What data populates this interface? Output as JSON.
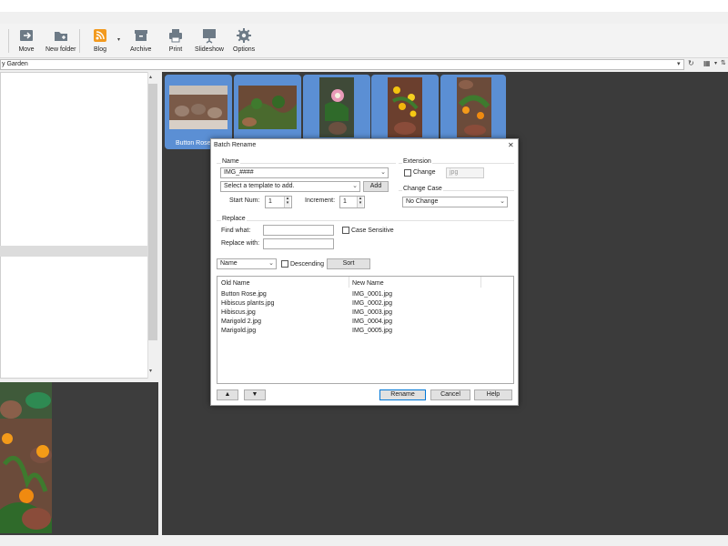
{
  "toolbar": {
    "buttons": [
      {
        "id": "move",
        "label": "Move"
      },
      {
        "id": "newfolder",
        "label": "New folder"
      },
      {
        "id": "blog",
        "label": "Blog"
      },
      {
        "id": "archive",
        "label": "Archive"
      },
      {
        "id": "print",
        "label": "Print"
      },
      {
        "id": "slideshow",
        "label": "Slideshow"
      },
      {
        "id": "options",
        "label": "Options"
      }
    ]
  },
  "address": {
    "value": "y Garden"
  },
  "gallery": {
    "thumbs": [
      {
        "label": "Button Rose"
      }
    ]
  },
  "dialog": {
    "title": "Batch Rename",
    "name_group": "Name",
    "name_value": "IMG_####",
    "template_placeholder": "Select a template to add.",
    "add_label": "Add",
    "start_num_label": "Start Num:",
    "start_num_value": "1",
    "increment_label": "Increment:",
    "increment_value": "1",
    "extension_group": "Extension",
    "change_label": "Change",
    "ext_value": "jpg",
    "change_case_group": "Change Case",
    "case_value": "No Change",
    "replace_group": "Replace",
    "find_label": "Find what:",
    "replace_label": "Replace with:",
    "case_sensitive_label": "Case Sensitive",
    "sort_by_value": "Name",
    "descending_label": "Descending",
    "sort_label": "Sort",
    "col_old": "Old Name",
    "col_new": "New Name",
    "rows": [
      {
        "old": "Button Rose.jpg",
        "new": "IMG_0001.jpg"
      },
      {
        "old": "Hibiscus plants.jpg",
        "new": "IMG_0002.jpg"
      },
      {
        "old": "Hibiscus.jpg",
        "new": "IMG_0003.jpg"
      },
      {
        "old": "Marigold 2.jpg",
        "new": "IMG_0004.jpg"
      },
      {
        "old": "Marigold.jpg",
        "new": "IMG_0005.jpg"
      }
    ],
    "up_label": "▲",
    "down_label": "▼",
    "rename_label": "Rename",
    "cancel_label": "Cancel",
    "help_label": "Help",
    "close_label": "✕"
  },
  "colors": {
    "accent": "#5b8fd4",
    "gallery_bg": "#3b3b3b"
  }
}
